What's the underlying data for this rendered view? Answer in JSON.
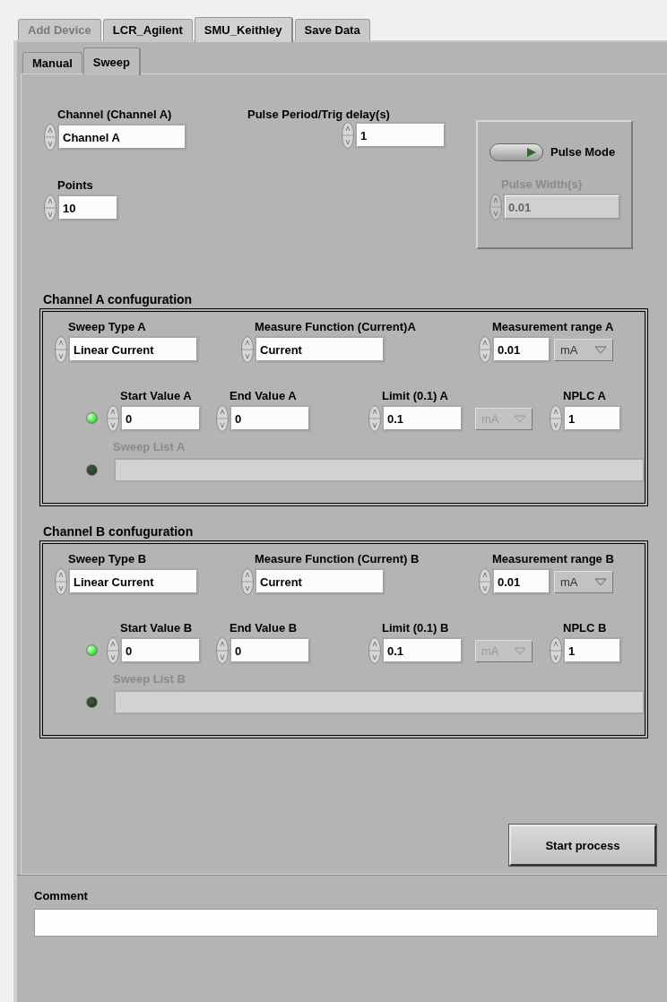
{
  "tabs": [
    {
      "label": "Add Device",
      "selected": false,
      "disabled": true
    },
    {
      "label": "LCR_Agilent",
      "selected": false,
      "disabled": false
    },
    {
      "label": "SMU_Keithley",
      "selected": true,
      "disabled": false
    },
    {
      "label": "Save Data",
      "selected": false,
      "disabled": false
    }
  ],
  "subtabs": [
    {
      "label": "Manual",
      "selected": false
    },
    {
      "label": "Sweep",
      "selected": true
    }
  ],
  "channel": {
    "label": "Channel (Channel A)",
    "value": "Channel A"
  },
  "pulse_period": {
    "label": "Pulse Period/Trig delay(s)",
    "value": "1"
  },
  "points": {
    "label": "Points",
    "value": "10"
  },
  "pulse_mode": {
    "label": "Pulse Mode",
    "on": false
  },
  "pulse_width": {
    "label": "Pulse Width(s)",
    "value": "0.01",
    "disabled": true
  },
  "channel_configs": [
    {
      "title": "Channel A confuguration",
      "sweep_type": {
        "label": "Sweep Type A",
        "value": "Linear Current"
      },
      "measure_function": {
        "label": "Measure Function (Current)A",
        "value": "Current"
      },
      "measurement_range": {
        "label": "Measurement range A",
        "value": "0.01",
        "unit": "mA",
        "unit_disabled": false
      },
      "linear_led_on": true,
      "start_value": {
        "label": "Start Value A",
        "value": "0"
      },
      "end_value": {
        "label": "End Value A",
        "value": "0"
      },
      "limit": {
        "label": "Limit (0.1) A",
        "value": "0.1",
        "unit": "mA",
        "unit_disabled": true
      },
      "nplc": {
        "label": "NPLC A",
        "value": "1"
      },
      "sweep_list": {
        "label": "Sweep List A",
        "disabled": true,
        "led_on": false
      }
    },
    {
      "title": "Channel B confuguration",
      "sweep_type": {
        "label": "Sweep Type B",
        "value": "Linear Current"
      },
      "measure_function": {
        "label": "Measure Function (Current) B",
        "value": "Current"
      },
      "measurement_range": {
        "label": "Measurement range B",
        "value": "0.01",
        "unit": "mA",
        "unit_disabled": false
      },
      "linear_led_on": true,
      "start_value": {
        "label": "Start Value B",
        "value": "0"
      },
      "end_value": {
        "label": "End Value B",
        "value": "0"
      },
      "limit": {
        "label": "Limit (0.1) B",
        "value": "0.1",
        "unit": "mA",
        "unit_disabled": true
      },
      "nplc": {
        "label": "NPLC B",
        "value": "1"
      },
      "sweep_list": {
        "label": "Sweep List B",
        "disabled": true,
        "led_on": false
      }
    }
  ],
  "start_button": "Start process",
  "comment": {
    "label": "Comment"
  }
}
